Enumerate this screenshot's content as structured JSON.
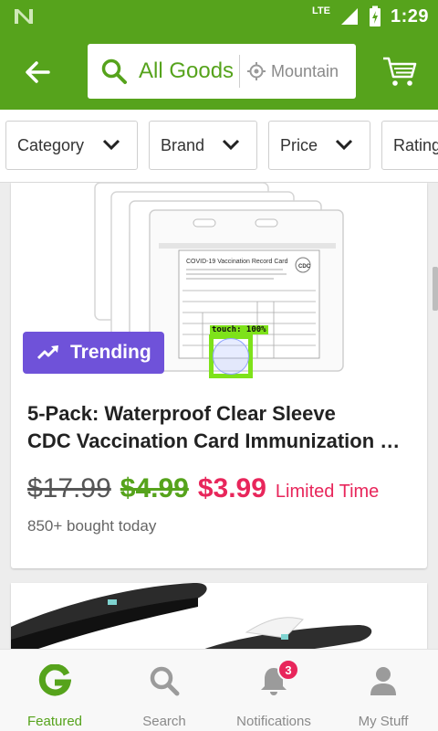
{
  "status_bar": {
    "network": "LTE",
    "time": "1:29"
  },
  "header": {
    "search": {
      "query": "All Goods",
      "location": "Mountain"
    },
    "icons": {
      "back": "arrow-left-icon",
      "search": "search-icon",
      "location": "location-target-icon",
      "cart": "cart-icon"
    }
  },
  "filters": [
    {
      "label": "Category"
    },
    {
      "label": "Brand"
    },
    {
      "label": "Price"
    },
    {
      "label": "Rating"
    }
  ],
  "product_1": {
    "badge": "Trending",
    "title_line_1": "5-Pack: Waterproof Clear Sleeve",
    "title_line_2": "CDC Vaccination Card Immunization Record Holder",
    "price_original": "$17.99",
    "price_previous": "$4.99",
    "price_current": "$3.99",
    "deal_label": "Limited Time",
    "sold_text": "850+ bought today",
    "image_card_title": "COVID-19 Vaccination Record Card"
  },
  "touch_overlay": {
    "label": "touch: 100%"
  },
  "bottom_nav": [
    {
      "label": "Featured",
      "icon": "featured-g-icon",
      "active": true
    },
    {
      "label": "Search",
      "icon": "search-icon",
      "active": false
    },
    {
      "label": "Notifications",
      "icon": "bell-icon",
      "active": false,
      "badge": "3"
    },
    {
      "label": "My Stuff",
      "icon": "person-icon",
      "active": false
    }
  ],
  "colors": {
    "brand_green": "#56a31c",
    "trending_purple": "#6f52d9",
    "sale_red": "#e8265b",
    "touch_green": "#7ee21a"
  }
}
